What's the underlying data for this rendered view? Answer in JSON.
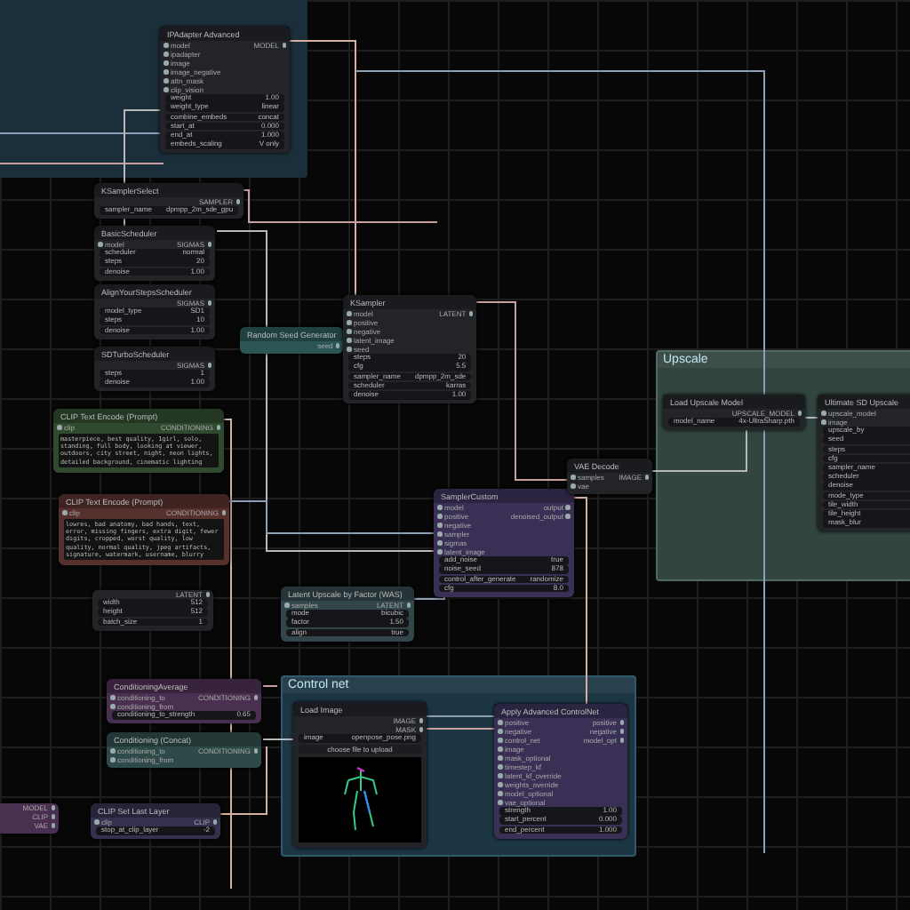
{
  "groups": [
    {
      "title": "Upscale"
    },
    {
      "title": "Control net"
    }
  ],
  "nodes": [
    {
      "title": "IPAdapter Advanced",
      "color": "#232428",
      "rows": [
        {
          "kind": "io",
          "left": "model",
          "right": "MODEL"
        },
        {
          "kind": "input",
          "label": "ipadapter"
        },
        {
          "kind": "input",
          "label": "image"
        },
        {
          "kind": "input",
          "label": "image_negative"
        },
        {
          "kind": "input",
          "label": "attn_mask"
        },
        {
          "kind": "input",
          "label": "clip_vision"
        },
        {
          "kind": "widget",
          "label": "weight",
          "value": "1.00"
        },
        {
          "kind": "widget",
          "label": "weight_type",
          "value": "linear"
        },
        {
          "kind": "widget",
          "label": "combine_embeds",
          "value": "concat"
        },
        {
          "kind": "widget",
          "label": "start_at",
          "value": "0.000"
        },
        {
          "kind": "widget",
          "label": "end_at",
          "value": "1.000"
        },
        {
          "kind": "widget",
          "label": "embeds_scaling",
          "value": "V only"
        }
      ]
    },
    {
      "title": "KSamplerSelect",
      "color": "#232428",
      "rows": [
        {
          "kind": "output",
          "label": "SAMPLER"
        },
        {
          "kind": "widget",
          "label": "sampler_name",
          "value": "dpmpp_2m_sde_gpu"
        }
      ]
    },
    {
      "title": "BasicScheduler",
      "color": "#232428",
      "rows": [
        {
          "kind": "io",
          "left": "model",
          "right": "SIGMAS"
        },
        {
          "kind": "widget",
          "label": "scheduler",
          "value": "normal"
        },
        {
          "kind": "widget",
          "label": "steps",
          "value": "20"
        },
        {
          "kind": "widget",
          "label": "denoise",
          "value": "1.00"
        }
      ]
    },
    {
      "title": "AlignYourStepsScheduler",
      "color": "#232428",
      "rows": [
        {
          "kind": "output",
          "label": "SIGMAS"
        },
        {
          "kind": "widget",
          "label": "model_type",
          "value": "SD1"
        },
        {
          "kind": "widget",
          "label": "steps",
          "value": "10"
        },
        {
          "kind": "widget",
          "label": "denoise",
          "value": "1.00"
        }
      ]
    },
    {
      "title": "SDTurboScheduler",
      "color": "#232428",
      "rows": [
        {
          "kind": "output",
          "label": "SIGMAS"
        },
        {
          "kind": "widget",
          "label": "steps",
          "value": "1"
        },
        {
          "kind": "widget",
          "label": "denoise",
          "value": "1.00"
        }
      ]
    },
    {
      "title": "Random Seed Generator",
      "color": "#2c5656",
      "rows": [
        {
          "kind": "output",
          "label": "seed"
        }
      ]
    },
    {
      "title": "KSampler",
      "color": "#232428",
      "rows": [
        {
          "kind": "io",
          "left": "model",
          "right": "LATENT"
        },
        {
          "kind": "input",
          "label": "positive"
        },
        {
          "kind": "input",
          "label": "negative"
        },
        {
          "kind": "input",
          "label": "latent_image"
        },
        {
          "kind": "input",
          "label": "seed"
        },
        {
          "kind": "widget",
          "label": "steps",
          "value": "20"
        },
        {
          "kind": "widget",
          "label": "cfg",
          "value": "5.5"
        },
        {
          "kind": "widget",
          "label": "sampler_name",
          "value": "dpmpp_2m_sde"
        },
        {
          "kind": "widget",
          "label": "scheduler",
          "value": "karras"
        },
        {
          "kind": "widget",
          "label": "denoise",
          "value": "1.00"
        }
      ]
    },
    {
      "title": "CLIP Text Encode (Prompt)",
      "color": "#2f4a2f",
      "rows": [
        {
          "kind": "io",
          "left": "clip",
          "right": "CONDITIONING"
        },
        {
          "kind": "text",
          "value": "masterpiece, best quality, 1girl, solo, standing, full body, looking at viewer, outdoors, city street, night, neon lights, detailed background, cinematic lighting"
        }
      ]
    },
    {
      "title": "CLIP Text Encode (Prompt)",
      "color": "#55302c",
      "rows": [
        {
          "kind": "io",
          "left": "clip",
          "right": "CONDITIONING"
        },
        {
          "kind": "text",
          "value": "lowres, bad anatomy, bad hands, text, error, missing fingers, extra digit, fewer digits, cropped, worst quality, low quality, normal quality, jpeg artifacts, signature, watermark, username, blurry"
        }
      ]
    },
    {
      "color": "#232428",
      "rows": [
        {
          "kind": "output",
          "label": "LATENT"
        },
        {
          "kind": "widget",
          "label": "width",
          "value": "512"
        },
        {
          "kind": "widget",
          "label": "height",
          "value": "512"
        },
        {
          "kind": "widget",
          "label": "batch_size",
          "value": "1"
        }
      ]
    },
    {
      "title": "SamplerCustom",
      "color": "#3a3056",
      "rows": [
        {
          "kind": "io",
          "left": "model",
          "right": "output"
        },
        {
          "kind": "io",
          "left": "positive",
          "right": "denoised_output"
        },
        {
          "kind": "input",
          "label": "negative"
        },
        {
          "kind": "input",
          "label": "sampler"
        },
        {
          "kind": "input",
          "label": "sigmas"
        },
        {
          "kind": "input",
          "label": "latent_image"
        },
        {
          "kind": "widget",
          "label": "add_noise",
          "value": "true"
        },
        {
          "kind": "widget",
          "label": "noise_seed",
          "value": "878"
        },
        {
          "kind": "widget",
          "label": "control_after_generate",
          "value": "randomize"
        },
        {
          "kind": "widget",
          "label": "cfg",
          "value": "8.0"
        }
      ]
    },
    {
      "title": "VAE Decode",
      "color": "#232428",
      "rows": [
        {
          "kind": "io",
          "left": "samples",
          "right": "IMAGE"
        },
        {
          "kind": "input",
          "label": "vae"
        }
      ]
    },
    {
      "title": "Load Upscale Model",
      "color": "#232428",
      "rows": [
        {
          "kind": "output",
          "label": "UPSCALE_MODEL"
        },
        {
          "kind": "widget",
          "label": "model_name",
          "value": "4x-UltraSharp.pth"
        }
      ]
    },
    {
      "title": "Ultimate SD Upscale",
      "color": "#232428",
      "rows": [
        {
          "kind": "input",
          "label": "upscale_model"
        },
        {
          "kind": "input",
          "label": "image"
        },
        {
          "kind": "widget",
          "label": "upscale_by"
        },
        {
          "kind": "widget",
          "label": "seed"
        },
        {
          "kind": "widget",
          "label": "steps"
        },
        {
          "kind": "widget",
          "label": "cfg"
        },
        {
          "kind": "widget",
          "label": "sampler_name"
        },
        {
          "kind": "widget",
          "label": "scheduler"
        },
        {
          "kind": "widget",
          "label": "denoise"
        },
        {
          "kind": "widget",
          "label": "mode_type"
        },
        {
          "kind": "widget",
          "label": "tile_width"
        },
        {
          "kind": "widget",
          "label": "tile_height"
        },
        {
          "kind": "widget",
          "label": "mask_blur"
        }
      ]
    },
    {
      "title": "Latent Upscale by Factor (WAS)",
      "color": "#33464a",
      "rows": [
        {
          "kind": "io",
          "left": "samples",
          "right": "LATENT"
        },
        {
          "kind": "widget",
          "label": "mode",
          "value": "bicubic"
        },
        {
          "kind": "widget",
          "label": "factor",
          "value": "1.50"
        },
        {
          "kind": "widget",
          "label": "align",
          "value": "true"
        }
      ]
    },
    {
      "title": "ConditioningAverage",
      "color": "#4a3050",
      "rows": [
        {
          "kind": "io",
          "left": "conditioning_to",
          "right": "CONDITIONING"
        },
        {
          "kind": "input",
          "label": "conditioning_from"
        },
        {
          "kind": "widget",
          "label": "conditioning_to_strength",
          "value": "0.65"
        }
      ]
    },
    {
      "title": "Conditioning (Concat)",
      "color": "#2e4a48",
      "rows": [
        {
          "kind": "io",
          "left": "conditioning_to",
          "right": "CONDITIONING"
        },
        {
          "kind": "input",
          "label": "conditioning_from"
        }
      ]
    },
    {
      "color": "#4a3050",
      "rows": [
        {
          "kind": "output",
          "label": "MODEL"
        },
        {
          "kind": "output",
          "label": "CLIP"
        },
        {
          "kind": "output",
          "label": "VAE"
        }
      ]
    },
    {
      "title": "CLIP Set Last Layer",
      "color": "#34304e",
      "rows": [
        {
          "kind": "io",
          "left": "clip",
          "right": "CLIP"
        },
        {
          "kind": "widget",
          "label": "stop_at_clip_layer",
          "value": "-2"
        }
      ]
    },
    {
      "title": "Load Image",
      "color": "#232428",
      "rows": [
        {
          "kind": "output",
          "label": "IMAGE"
        },
        {
          "kind": "output",
          "label": "MASK"
        },
        {
          "kind": "widget",
          "label": "image",
          "value": "openpose_pose.png"
        },
        {
          "kind": "button",
          "label": "choose file to upload"
        },
        {
          "kind": "image"
        }
      ]
    },
    {
      "title": "Apply Advanced ControlNet",
      "color": "#3a3056",
      "rows": [
        {
          "kind": "io",
          "left": "positive",
          "right": "positive"
        },
        {
          "kind": "io",
          "left": "negative",
          "right": "negative"
        },
        {
          "kind": "io",
          "left": "control_net",
          "right": "model_opt"
        },
        {
          "kind": "input",
          "label": "image"
        },
        {
          "kind": "input",
          "label": "mask_optional"
        },
        {
          "kind": "input",
          "label": "timestep_kf"
        },
        {
          "kind": "input",
          "label": "latent_kf_override"
        },
        {
          "kind": "input",
          "label": "weights_override"
        },
        {
          "kind": "input",
          "label": "model_optional"
        },
        {
          "kind": "input",
          "label": "vae_optional"
        },
        {
          "kind": "widget",
          "label": "strength",
          "value": "1.00"
        },
        {
          "kind": "widget",
          "label": "start_percent",
          "value": "0.000"
        },
        {
          "kind": "widget",
          "label": "end_percent",
          "value": "1.000"
        }
      ]
    }
  ]
}
